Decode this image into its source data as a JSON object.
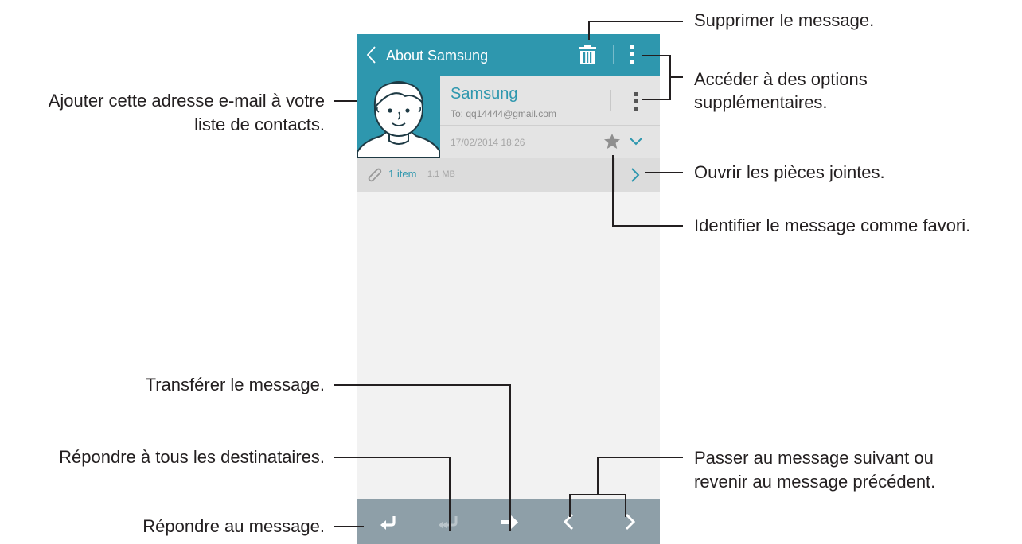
{
  "email": {
    "topbar": {
      "title": "About Samsung",
      "back_icon": "chevron-left-icon",
      "delete_icon": "trash-icon",
      "more_icon": "more-vertical-icon"
    },
    "header": {
      "sender": "Samsung",
      "to": "To: qq14444@gmail.com",
      "date": "17/02/2014  18:26",
      "favorite_icon": "star-icon",
      "expand_icon": "chevron-down-icon"
    },
    "attachments": {
      "count": "1 item",
      "size": "1.1 MB",
      "open_icon": "chevron-right-icon"
    },
    "bottombar": [
      "reply-icon",
      "reply-all-icon",
      "forward-icon",
      "previous-icon",
      "next-icon"
    ]
  },
  "callouts": {
    "delete": "Supprimer le message.",
    "more_line1": "Accéder à des options",
    "more_line2": "supplémentaires.",
    "add_contact_line1": "Ajouter cette adresse e-mail à votre",
    "add_contact_line2": "liste de contacts.",
    "attachments": "Ouvrir les pièces jointes.",
    "favorite": "Identifier le message comme favori.",
    "forward": "Transférer le message.",
    "reply_all": "Répondre à tous les destinataires.",
    "reply": "Répondre au message.",
    "nav_line1": "Passer au message suivant ou",
    "nav_line2": "revenir au message précédent."
  },
  "colors": {
    "accent": "#2e97ae",
    "header_bg": "#e4e4e4",
    "attach_bg": "#dcdcdc",
    "body_bg": "#f2f2f2",
    "bottombar": "#8e9fa8",
    "text": "#231f20"
  }
}
